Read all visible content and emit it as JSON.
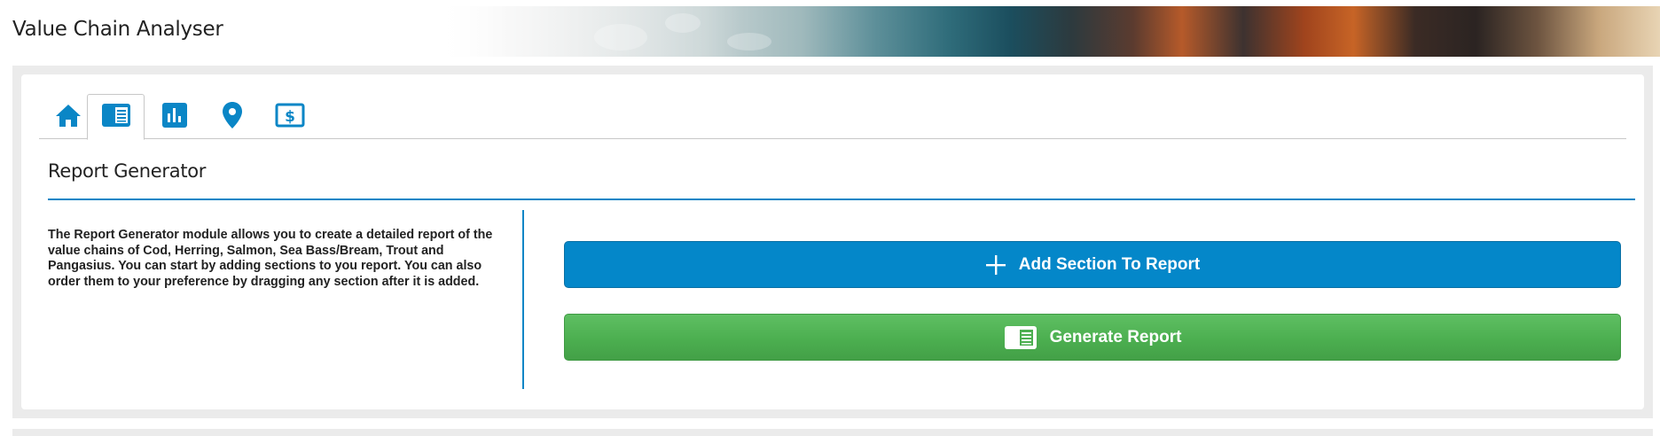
{
  "app": {
    "title": "Value Chain Analyser"
  },
  "tabs": [
    {
      "id": "home",
      "icon": "home-icon",
      "active": false
    },
    {
      "id": "report",
      "icon": "report-icon",
      "active": true
    },
    {
      "id": "charts",
      "icon": "bar-chart-icon",
      "active": false
    },
    {
      "id": "map",
      "icon": "map-pin-icon",
      "active": false
    },
    {
      "id": "finance",
      "icon": "dollar-icon",
      "active": false
    }
  ],
  "section": {
    "title": "Report Generator",
    "description": "The Report Generator module allows you to create a detailed report of the value chains of Cod, Herring, Salmon, Sea Bass/Bream, Trout and Pangasius. You can start by adding sections to you report. You can also order them to your preference by dragging any section after it is added."
  },
  "actions": {
    "add_section_label": "Add Section To Report",
    "generate_label": "Generate Report"
  },
  "colors": {
    "accent": "#0a86c6",
    "primary_button": "#0487c9",
    "success_button": "#4caf50",
    "background": "#ebebeb"
  }
}
